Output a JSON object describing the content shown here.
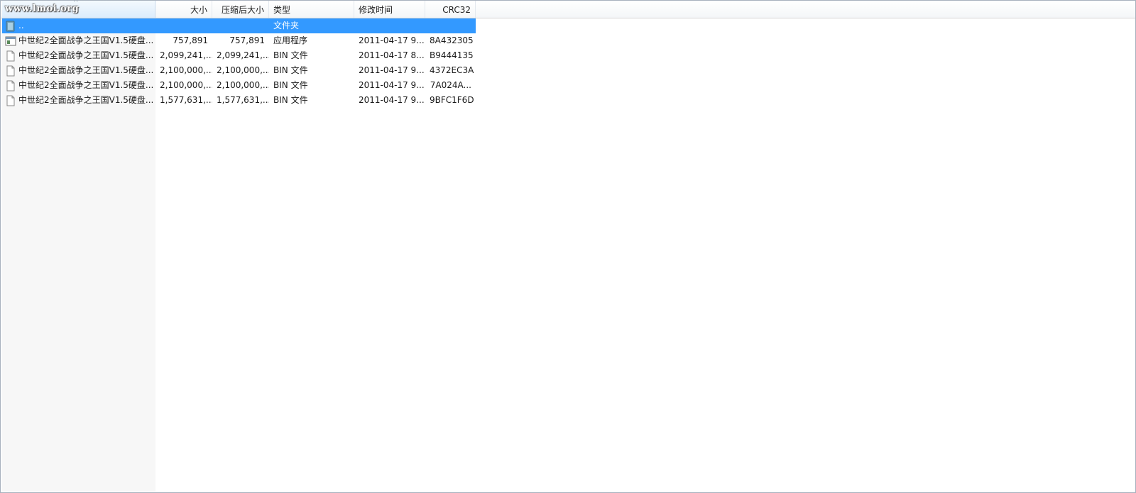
{
  "watermark": "www.lmoi.org",
  "columns": {
    "name": "",
    "size": "大小",
    "packed": "压缩后大小",
    "type": "类型",
    "modified": "修改时间",
    "crc": "CRC32"
  },
  "rows": [
    {
      "name": "..",
      "size": "",
      "packed": "",
      "type": "文件夹",
      "modified": "",
      "crc": "",
      "icon": "folder-up-icon"
    },
    {
      "name": "中世纪2全面战争之王国V1.5硬盘...",
      "size": "757,891",
      "packed": "757,891",
      "type": "应用程序",
      "modified": "2011-04-17 9...",
      "crc": "8A432305",
      "icon": "application-icon"
    },
    {
      "name": "中世纪2全面战争之王国V1.5硬盘...",
      "size": "2,099,241,...",
      "packed": "2,099,241,...",
      "type": "BIN 文件",
      "modified": "2011-04-17 8...",
      "crc": "B9444135",
      "icon": "file-icon"
    },
    {
      "name": "中世纪2全面战争之王国V1.5硬盘...",
      "size": "2,100,000,...",
      "packed": "2,100,000,...",
      "type": "BIN 文件",
      "modified": "2011-04-17 9...",
      "crc": "4372EC3A",
      "icon": "file-icon"
    },
    {
      "name": "中世纪2全面战争之王国V1.5硬盘...",
      "size": "2,100,000,...",
      "packed": "2,100,000,...",
      "type": "BIN 文件",
      "modified": "2011-04-17 9...",
      "crc": "7A024A...",
      "icon": "file-icon"
    },
    {
      "name": "中世纪2全面战争之王国V1.5硬盘...",
      "size": "1,577,631,...",
      "packed": "1,577,631,...",
      "type": "BIN 文件",
      "modified": "2011-04-17 9...",
      "crc": "9BFC1F6D",
      "icon": "file-icon"
    }
  ],
  "colors": {
    "selection": "#3399ff",
    "name_column_bg": "#f7f7f7",
    "header_border": "#d5d5d5"
  }
}
